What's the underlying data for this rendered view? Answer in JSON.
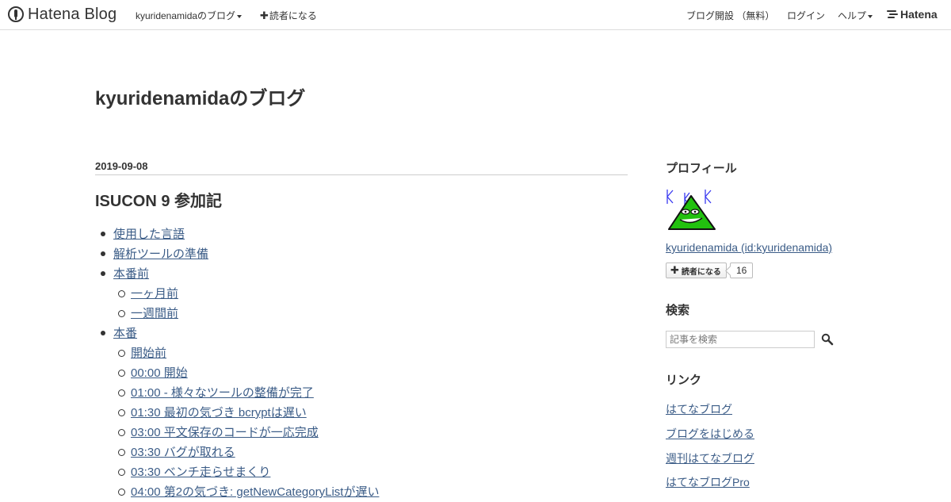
{
  "global_header": {
    "logo_text": "Hatena Blog",
    "blog_menu_label": "kyuridenamidaのブログ",
    "subscribe_label": "読者になる",
    "open_blog_label": "ブログ開設 （無料）",
    "login_label": "ログイン",
    "help_label": "ヘルプ",
    "hatena_label": "Hatena"
  },
  "blog": {
    "title": "kyuridenamidaのブログ"
  },
  "entry": {
    "date": "2019-09-08",
    "title": "ISUCON 9 参加記",
    "toc": [
      {
        "label": "使用した言語",
        "level": 1
      },
      {
        "label": "解析ツールの準備",
        "level": 1
      },
      {
        "label": "本番前",
        "level": 1
      },
      {
        "label": "一ヶ月前",
        "level": 2
      },
      {
        "label": "一週間前",
        "level": 2
      },
      {
        "label": "本番",
        "level": 1
      },
      {
        "label": "開始前",
        "level": 2
      },
      {
        "label": "00:00 開始",
        "level": 2
      },
      {
        "label": "01:00 - 様々なツールの整備が完了",
        "level": 2
      },
      {
        "label": "01:30 最初の気づき bcryptは遅い",
        "level": 2
      },
      {
        "label": "03:00 平文保存のコードが一応完成",
        "level": 2
      },
      {
        "label": "03:30 バグが取れる",
        "level": 2
      },
      {
        "label": "03:30 ベンチ走らせまくり",
        "level": 2
      },
      {
        "label": "04:00 第2の気づき: getNewCategoryListが遅い",
        "level": 2
      }
    ]
  },
  "sidebar": {
    "profile": {
      "heading": "プロフィール",
      "name": "kyuridenamida (id:kyuridenamida)",
      "subscribe_label": "読者になる",
      "subscriber_count": "16"
    },
    "search": {
      "heading": "検索",
      "placeholder": "記事を検索"
    },
    "links": {
      "heading": "リンク",
      "items": [
        "はてなブログ",
        "ブログをはじめる",
        "週刊はてなブログ",
        "はてなブログPro"
      ]
    }
  },
  "colors": {
    "link": "#3b5c87",
    "text": "#333333",
    "avatar_green": "#22c10f"
  }
}
